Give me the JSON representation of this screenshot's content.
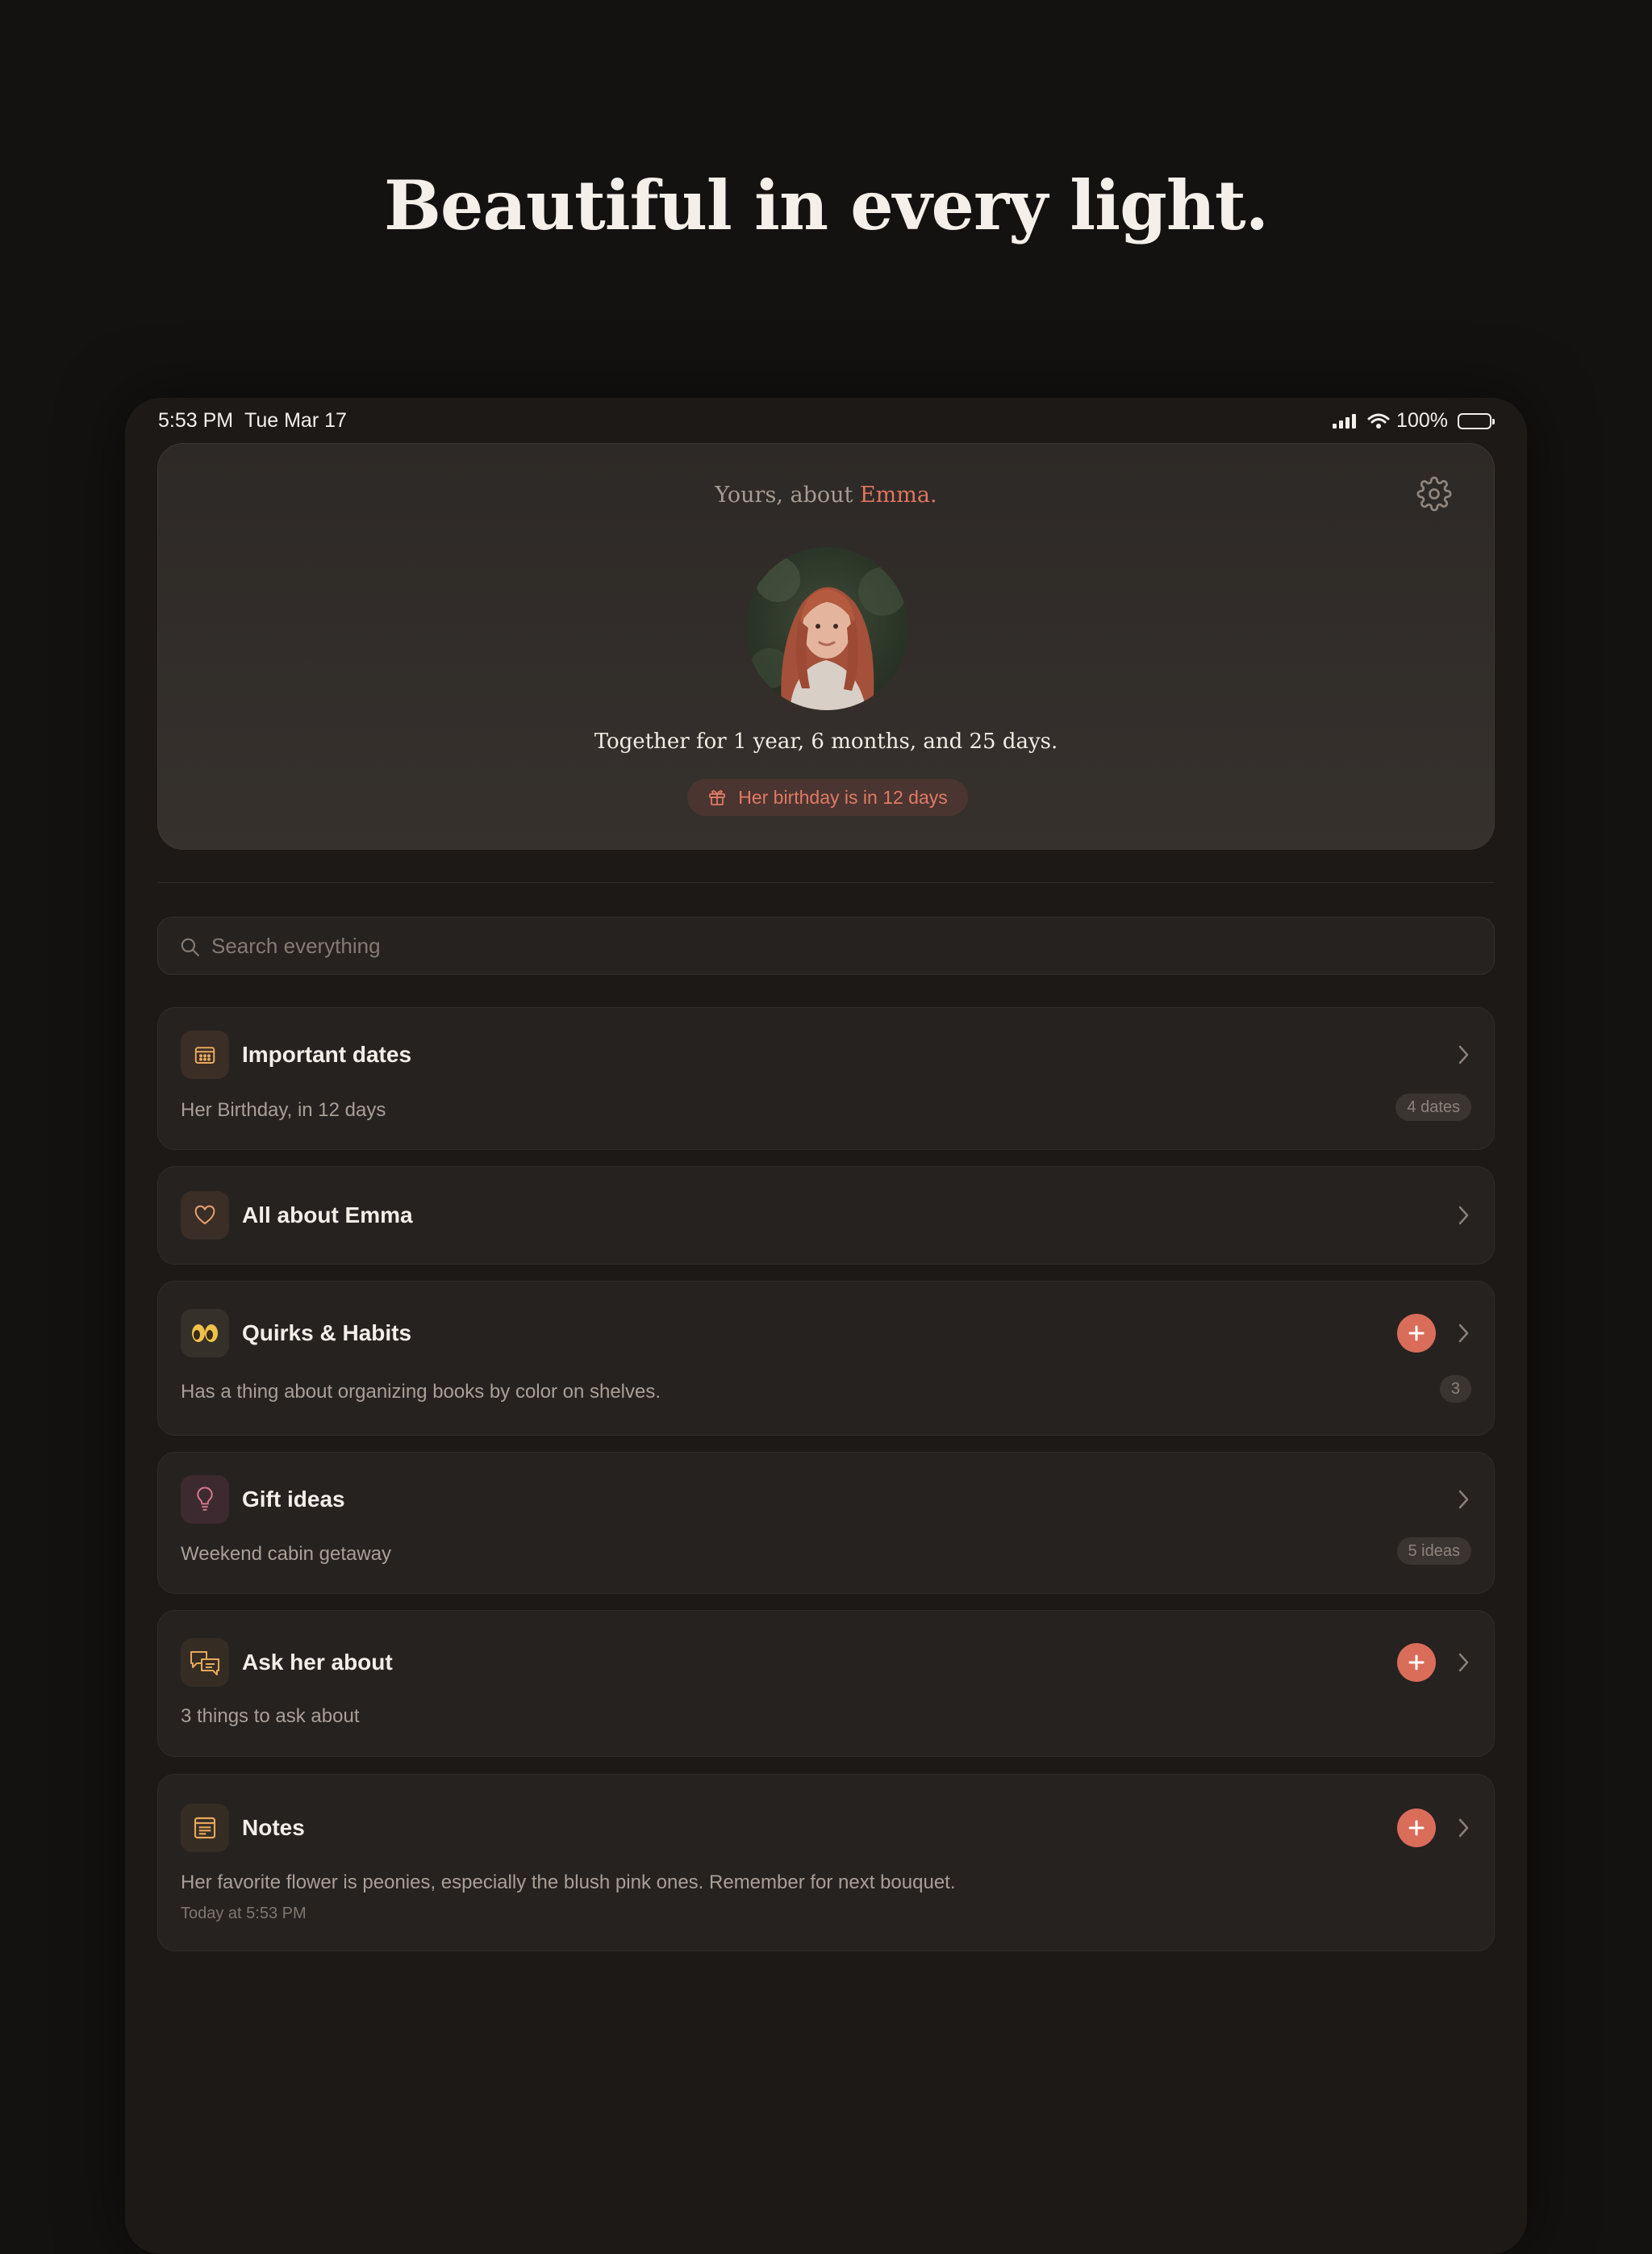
{
  "headline": "Beautiful in every light.",
  "status_bar": {
    "time": "5:53 PM",
    "date": "Tue Mar 17",
    "battery_text": "100%",
    "icons": [
      "cellular-signal-icon",
      "wifi-icon",
      "battery-icon"
    ]
  },
  "profile": {
    "title_prefix": "Yours, about",
    "name": "Emma",
    "title_suffix": ".",
    "together_text": "Together for 1 year, 6 months, and 25 days.",
    "birthday_text": "Her birthday is in 12 days"
  },
  "search": {
    "placeholder": "Search everything",
    "value": ""
  },
  "cards": {
    "dates": {
      "title": "Important dates",
      "subtitle": "Her Birthday, in 12 days",
      "badge": "4 dates",
      "icon": "calendar-icon"
    },
    "about": {
      "title": "All about Emma",
      "icon": "heart-icon"
    },
    "quirks": {
      "title": "Quirks & Habits",
      "subtitle": "Has a thing about organizing books by color on shelves.",
      "badge": "3",
      "icon": "eyes-icon"
    },
    "gifts": {
      "title": "Gift ideas",
      "subtitle": "Weekend cabin getaway",
      "badge": "5 ideas",
      "icon": "lightbulb-icon"
    },
    "ask": {
      "title": "Ask her about",
      "subtitle": "3 things to ask about",
      "icon": "speech-bubbles-icon"
    },
    "notes": {
      "title": "Notes",
      "subtitle": "Her favorite flower is peonies, especially the blush pink ones. Remember for next bouquet.",
      "meta": "Today at 5:53 PM",
      "icon": "note-icon"
    }
  },
  "colors": {
    "accent": "#e0755f",
    "plus_button": "#d96d5a",
    "background": "#1c1917",
    "card": "#262220"
  }
}
